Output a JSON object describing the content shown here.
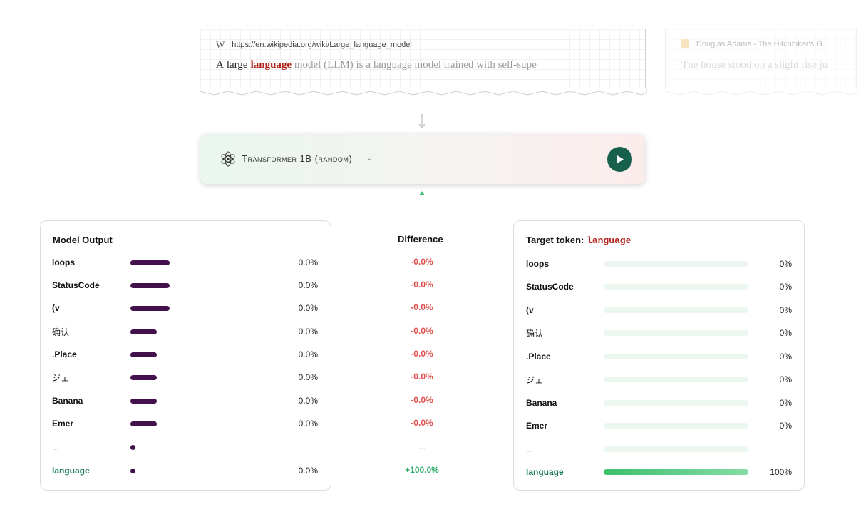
{
  "source1": {
    "url": "https://en.wikipedia.org/wiki/Large_language_model",
    "token_a": "A",
    "token_large": "large",
    "token_target": "language",
    "rest": "model (LLM) is a language model trained with self-supe"
  },
  "source2": {
    "title": "Douglas Adams - The Hitchhiker's G...",
    "text": "The house stood on a slight rise ju"
  },
  "model": {
    "name": "Transformer 1B (random)",
    "chevron": "⌄"
  },
  "output_panel": {
    "title": "Model Output"
  },
  "difference_panel": {
    "title": "Difference"
  },
  "target_panel": {
    "title_prefix": "Target token: ",
    "token": "language"
  },
  "rows": [
    {
      "token": "loops",
      "prob": "0.0%",
      "diff": "-0.0%",
      "target": "0%",
      "bar": 0.27,
      "fill": 0
    },
    {
      "token": "StatusCode",
      "prob": "0.0%",
      "diff": "-0.0%",
      "target": "0%",
      "bar": 0.27,
      "fill": 0
    },
    {
      "token": "(v",
      "prob": "0.0%",
      "diff": "-0.0%",
      "target": "0%",
      "bar": 0.27,
      "fill": 0
    },
    {
      "token": "确认",
      "prob": "0.0%",
      "diff": "-0.0%",
      "target": "0%",
      "bar": 0.18,
      "fill": 0
    },
    {
      "token": ".Place",
      "prob": "0.0%",
      "diff": "-0.0%",
      "target": "0%",
      "bar": 0.18,
      "fill": 0
    },
    {
      "token": "ジェ",
      "prob": "0.0%",
      "diff": "-0.0%",
      "target": "0%",
      "bar": 0.18,
      "fill": 0
    },
    {
      "token": "Banana",
      "prob": "0.0%",
      "diff": "-0.0%",
      "target": "0%",
      "bar": 0.18,
      "fill": 0
    },
    {
      "token": "Emer",
      "prob": "0.0%",
      "diff": "-0.0%",
      "target": "0%",
      "bar": 0.18,
      "fill": 0
    },
    {
      "token": "...",
      "prob": "",
      "diff": "...",
      "target": "",
      "bar": 0,
      "fill": 0
    },
    {
      "token": "language",
      "prob": "0.0%",
      "diff": "+100.0%",
      "target": "100%",
      "bar": 0,
      "fill": 1.0
    }
  ],
  "colors": {
    "bar": "#42104a",
    "diff_negative": "#e0524e",
    "diff_positive": "#2fa96a",
    "target_fill": "#3cbf6d",
    "play_button": "#17604c",
    "target_token": "#b3261e"
  },
  "icons": {
    "source1": "wikipedia-w-icon",
    "source2": "book-icon",
    "model": "atom-icon",
    "play": "play-icon"
  }
}
